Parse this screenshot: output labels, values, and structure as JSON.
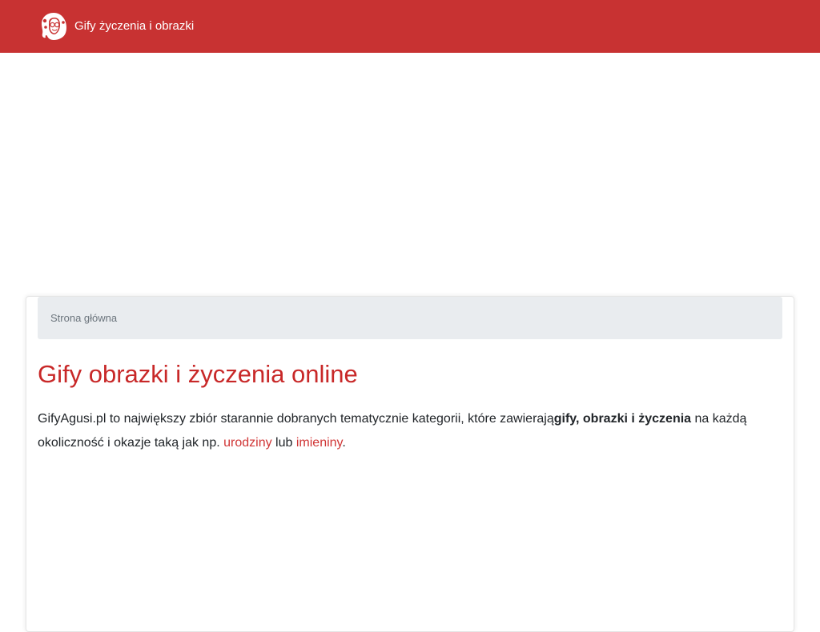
{
  "navbar": {
    "brand_text": "Gify życzenia i obrazki",
    "logo_icon": "woman-portrait-logo-icon",
    "background_color": "#c83232"
  },
  "breadcrumb": {
    "items": [
      "Strona główna"
    ]
  },
  "main": {
    "title": "Gify obrazki i życzenia online",
    "intro": {
      "part1": "GifyAgusi.pl to największy zbiór starannie dobranych tematycznie kategorii, które zawierają",
      "bold": "gify, obrazki i życzenia",
      "part2": " na każdą okoliczność i okazje taką jak np. ",
      "link1": "urodziny",
      "part3": " lub ",
      "link2": "imieniny",
      "part4": "."
    },
    "accent_color": "#c82828",
    "link_color": "#d03535"
  }
}
